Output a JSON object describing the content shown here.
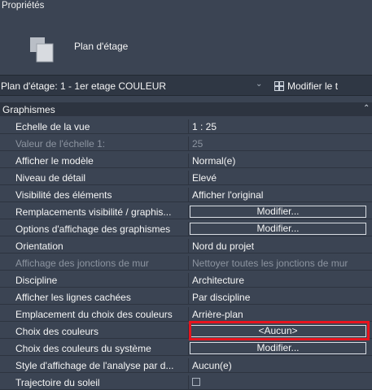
{
  "panel": {
    "title": "Propriétés"
  },
  "type": {
    "icon": "floor-plan-view-icon",
    "name": "Plan d'étage"
  },
  "selector": {
    "value": "Plan d'étage: 1 - 1er etage COULEUR",
    "edit_label": "Modifier le t"
  },
  "section": {
    "name": "Graphismes"
  },
  "rows": [
    {
      "name": "Echelle de la vue",
      "value": "1 : 25"
    },
    {
      "name": "Valeur de l'échelle    1:",
      "value": "25"
    },
    {
      "name": "Afficher le modèle",
      "value": "Normal(e)"
    },
    {
      "name": "Niveau de détail",
      "value": "Elevé"
    },
    {
      "name": "Visibilité des éléments",
      "value": "Afficher l'original"
    },
    {
      "name": "Remplacements visibilité / graphis...",
      "value": "Modifier..."
    },
    {
      "name": "Options d'affichage des graphismes",
      "value": "Modifier..."
    },
    {
      "name": "Orientation",
      "value": "Nord du projet"
    },
    {
      "name": "Affichage des jonctions de mur",
      "value": "Nettoyer toutes les jonctions de mur"
    },
    {
      "name": "Discipline",
      "value": "Architecture"
    },
    {
      "name": "Afficher les lignes cachées",
      "value": "Par discipline"
    },
    {
      "name": "Emplacement du choix des couleurs",
      "value": "Arrière-plan"
    },
    {
      "name": "Choix des couleurs",
      "value": "<Aucun>"
    },
    {
      "name": "Choix des couleurs du système",
      "value": "Modifier..."
    },
    {
      "name": "Style d'affichage de l'analyse par d...",
      "value": "Aucun(e)"
    },
    {
      "name": "Trajectoire du soleil",
      "value": ""
    }
  ],
  "colors": {
    "background": "#3b4453",
    "highlight": "#e8141e"
  }
}
